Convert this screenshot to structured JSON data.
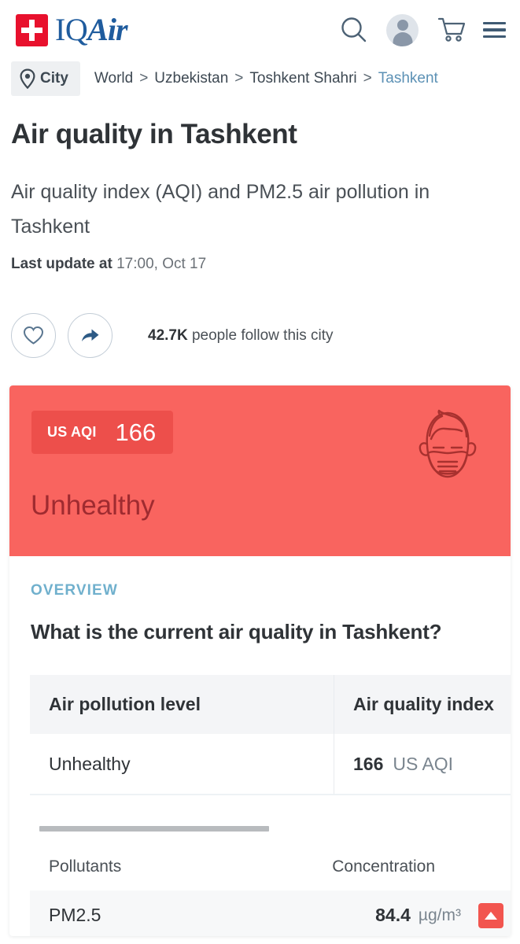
{
  "header": {
    "logo_text_primary": "IQ",
    "logo_text_secondary": "Air",
    "icons": [
      "search-icon",
      "account-avatar",
      "cart-icon",
      "menu-icon"
    ]
  },
  "breadcrumb": {
    "chip_label": "City",
    "items": [
      {
        "label": "World",
        "current": false
      },
      {
        "label": "Uzbekistan",
        "current": false
      },
      {
        "label": "Toshkent Shahri",
        "current": false
      },
      {
        "label": "Tashkent",
        "current": true
      }
    ],
    "separator": ">"
  },
  "page": {
    "title": "Air quality in Tashkent",
    "subtitle": "Air quality index (AQI) and PM2.5 air pollution in Tashkent",
    "last_update_label": "Last update at",
    "last_update_value": "17:00, Oct 17"
  },
  "follow": {
    "count": "42.7K",
    "text": "people follow this city",
    "favorite_icon": "heart-icon",
    "share_icon": "share-icon"
  },
  "aqi_banner": {
    "badge_label": "US AQI",
    "badge_value": "166",
    "status": "Unhealthy",
    "icon": "face-with-mask-icon",
    "bg_color": "#f9645f",
    "badge_bg_color": "#ed4f4b",
    "status_color": "#9f2b30"
  },
  "overview": {
    "section_label": "OVERVIEW",
    "section_label_color": "#70b0cd",
    "question": "What is the current air quality in Tashkent?"
  },
  "summary_table": {
    "headers": [
      "Air pollution level",
      "Air quality index"
    ],
    "row": {
      "pollution_level": "Unhealthy",
      "aqi_value": "166",
      "aqi_unit": "US AQI"
    }
  },
  "pollutants_table": {
    "headers": [
      "Pollutants",
      "Concentration"
    ],
    "rows": [
      {
        "name": "PM2.5",
        "value": "84.4",
        "unit": "µg/m³",
        "trend": "up",
        "trend_color": "#f2554f"
      }
    ]
  }
}
